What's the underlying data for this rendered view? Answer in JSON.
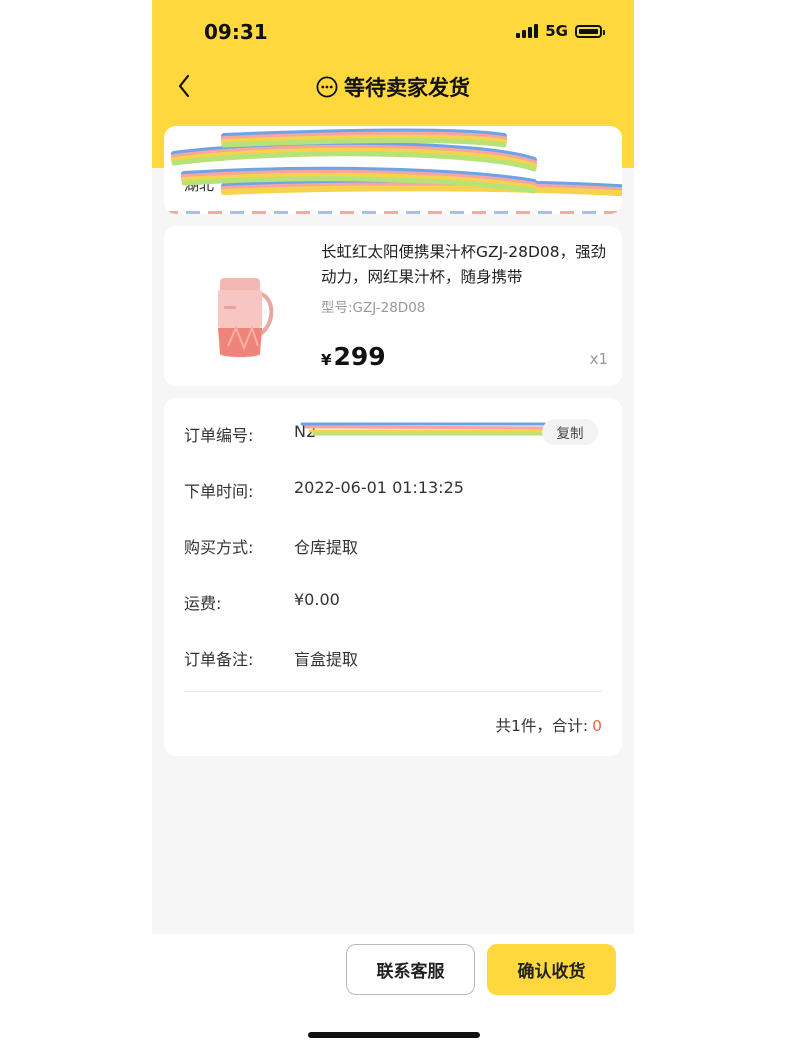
{
  "status_bar": {
    "time": "09:31",
    "network": "5G",
    "signal_icon": "signal-bars-icon",
    "battery_icon": "battery-icon"
  },
  "nav": {
    "back_icon": "chevron-left-icon",
    "title_icon": "ellipsis-circle-icon",
    "title": "等待卖家发货"
  },
  "address": {
    "label_fragment": "湖北"
  },
  "product": {
    "name": "长虹红太阳便携果汁杯GZJ-28D08，强劲动力，网红果汁杯，随身携带",
    "model": "型号:GZJ-28D08",
    "currency": "¥",
    "price": "299",
    "quantity": "x1"
  },
  "order": {
    "number_label": "订单编号:",
    "number_value": "N2",
    "copy_label": "复制",
    "time_label": "下单时间:",
    "time_value": "2022-06-01 01:13:25",
    "purchase_label": "购买方式:",
    "purchase_value": "仓库提取",
    "shipping_label": "运费:",
    "shipping_value": "¥0.00",
    "note_label": "订单备注:",
    "note_value": "盲盒提取",
    "total_text": "共1件，合计:",
    "total_value": "0"
  },
  "actions": {
    "contact_label": "联系客服",
    "confirm_label": "确认收货"
  },
  "colors": {
    "brand_yellow": "#fed83c",
    "background": "#f6f6f6",
    "total_accent": "#e86a3c"
  }
}
